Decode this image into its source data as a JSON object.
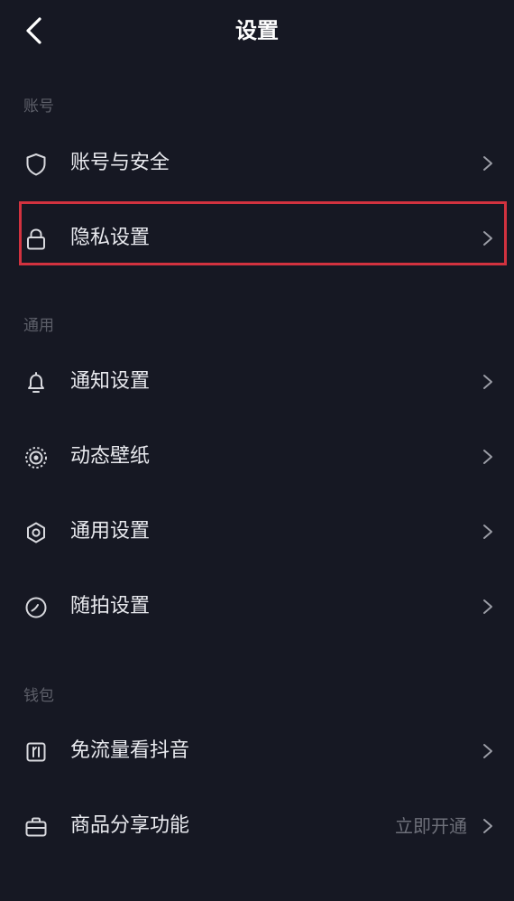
{
  "header": {
    "title": "设置",
    "back_icon": "chevron-left-icon"
  },
  "sections": {
    "account": {
      "label": "账号",
      "items": [
        {
          "label": "账号与安全",
          "icon": "shield-icon"
        },
        {
          "label": "隐私设置",
          "icon": "lock-icon"
        }
      ]
    },
    "general": {
      "label": "通用",
      "items": [
        {
          "label": "通知设置",
          "icon": "bell-icon"
        },
        {
          "label": "动态壁纸",
          "icon": "dynamic-wallpaper-icon"
        },
        {
          "label": "通用设置",
          "icon": "gear-icon"
        },
        {
          "label": "随拍设置",
          "icon": "casual-shot-icon"
        }
      ]
    },
    "wallet": {
      "label": "钱包",
      "items": [
        {
          "label": "免流量看抖音",
          "icon": "data-free-icon"
        },
        {
          "label": "商品分享功能",
          "icon": "briefcase-icon",
          "value": "立即开通"
        }
      ]
    }
  },
  "colors": {
    "background": "#161823",
    "highlight": "#d2323f"
  }
}
